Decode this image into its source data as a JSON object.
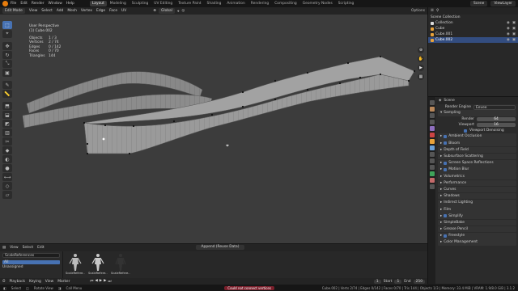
{
  "topbar": {
    "menus": [
      "File",
      "Edit",
      "Render",
      "Window",
      "Help"
    ],
    "workspaces": [
      "Layout",
      "Modeling",
      "Sculpting",
      "UV Editing",
      "Texture Paint",
      "Shading",
      "Animation",
      "Rendering",
      "Compositing",
      "Geometry Nodes",
      "Scripting"
    ],
    "active_workspace": "Layout",
    "scene": "Scene",
    "view_layer": "ViewLayer"
  },
  "header": {
    "mode": "Edit Mode",
    "menus": [
      "View",
      "Select",
      "Add",
      "Mesh",
      "Vertex",
      "Edge",
      "Face",
      "UV"
    ],
    "orientation": "Global",
    "options": "Options"
  },
  "viewport": {
    "overlay_line1": "User Perspective",
    "overlay_line2": "(1) Cube.002",
    "stats": [
      {
        "label": "Objects",
        "value": "1 / 3"
      },
      {
        "label": "Vertices",
        "value": "2 / 74"
      },
      {
        "label": "Edges",
        "value": "0 / 142"
      },
      {
        "label": "Faces",
        "value": "0 / 70"
      },
      {
        "label": "Triangles",
        "value": "144"
      }
    ],
    "mesh_color": "#9c9c9c",
    "background": "#3c3c3c"
  },
  "outliner": {
    "title": "Scene Collection",
    "rows": [
      {
        "label": "Collection",
        "color": "#dcdcdc"
      },
      {
        "label": "Cube",
        "color": "#e8a23a"
      },
      {
        "label": "Cube.001",
        "color": "#e8a23a"
      },
      {
        "label": "Cube.002",
        "color": "#e8a23a"
      }
    ],
    "selected": "Cube.002"
  },
  "properties": {
    "header": "Scene",
    "render_engine_label": "Render Engine",
    "render_engine": "Eevee",
    "sampling": "Sampling",
    "render_label": "Render",
    "render_samples": "64",
    "viewport_label": "Viewport",
    "viewport_samples": "16",
    "viewport_denoising": "Viewport Denoising",
    "panels": [
      {
        "label": "Ambient Occlusion",
        "checkbox": true
      },
      {
        "label": "Bloom",
        "checkbox": true
      },
      {
        "label": "Depth of Field",
        "checkbox": false
      },
      {
        "label": "Subsurface Scattering",
        "checkbox": false
      },
      {
        "label": "Screen Space Reflections",
        "checkbox": true
      },
      {
        "label": "Motion Blur",
        "checkbox": true
      },
      {
        "label": "Volumetrics",
        "checkbox": false
      },
      {
        "label": "Performance",
        "checkbox": false
      },
      {
        "label": "Curves",
        "checkbox": false
      },
      {
        "label": "Shadows",
        "checkbox": false
      },
      {
        "label": "Indirect Lighting",
        "checkbox": false
      },
      {
        "label": "Film",
        "checkbox": false
      },
      {
        "label": "Simplify",
        "checkbox": true
      },
      {
        "label": "SimpleBake",
        "checkbox": false
      },
      {
        "label": "Grease Pencil",
        "checkbox": false
      },
      {
        "label": "Freestyle",
        "checkbox": true
      },
      {
        "label": "Color Management",
        "checkbox": false
      }
    ]
  },
  "asset_browser": {
    "menus": [
      "View",
      "Select",
      "Edit"
    ],
    "library": "ScaleReferences",
    "categories": [
      "All",
      "Unassigned"
    ],
    "append_mode": "Append (Reuse Data)",
    "assets": [
      "ScaleRefere...",
      "ScaleRefere...",
      "ScaleRefere..."
    ]
  },
  "timeline": {
    "menus": [
      "Playback",
      "Keying",
      "View",
      "Marker"
    ],
    "current_frame": "1",
    "start_label": "Start",
    "start": "1",
    "end_label": "End",
    "end": "250"
  },
  "statusbar": {
    "left": [
      "Select",
      "Rotate View",
      "Call Menu"
    ],
    "warning": "Could not connect vertices",
    "right": "Cube.002 | Verts 2/74 | Edges 0/142 | Faces 0/70 | Tris 144 | Objects 1/3 | Memory: 33.4 MiB | VRAM: 1.9/8.0 GiB | 3.1.2"
  }
}
